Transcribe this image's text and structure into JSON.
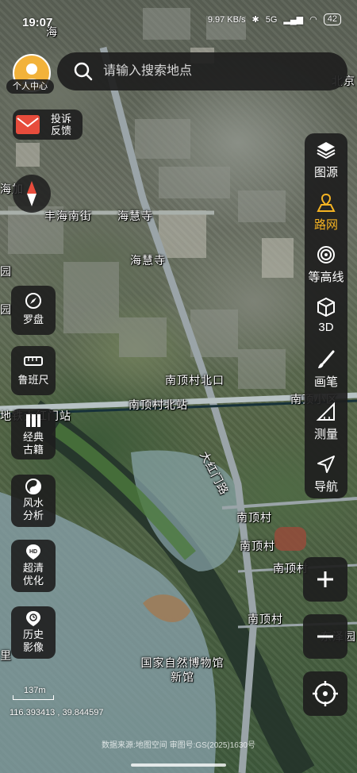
{
  "status_bar": {
    "time": "19:07",
    "net_speed": "9.97 KB/s",
    "signal": "5G",
    "battery": "42"
  },
  "search": {
    "placeholder": "请输入搜索地点"
  },
  "left_controls": {
    "profile_label": "个人中心",
    "feedback_label": "投诉反馈",
    "compass_label": "罗盘",
    "ruler_label": "鲁班尺",
    "classics_label": "经典古籍",
    "fengshui_label": "风水分析",
    "hd_label": "超清优化",
    "history_label": "历史影像"
  },
  "right_toolbar": {
    "items": [
      {
        "label": "图源",
        "icon": "layers-icon"
      },
      {
        "label": "路网",
        "icon": "road-network-icon"
      },
      {
        "label": "等高线",
        "icon": "contour-icon"
      },
      {
        "label": "3D",
        "icon": "cube-icon"
      },
      {
        "label": "画笔",
        "icon": "brush-icon"
      },
      {
        "label": "测量",
        "icon": "measure-icon"
      },
      {
        "label": "导航",
        "icon": "navigation-icon"
      }
    ],
    "active_index": 1,
    "active_color": "#f5b322"
  },
  "map_labels": {
    "fenghai_nanjie": "丰海南街",
    "haihuisi_1": "海慧寺",
    "haihuisi_2": "海慧寺",
    "nandingcun_beikou": "南顶村北口",
    "nandingcun_beizhan": "南顶村北站",
    "nanding_xiaoqu": "南顶小区",
    "dahongmen_lu": "大红门路",
    "nandingcun_1": "南顶村",
    "nandingcun_2": "南顶村",
    "nandingcun_3": "南顶村",
    "nandingcun_4": "南顶村",
    "dongzeyuan": "东泽园",
    "museum": "国家自然博物馆新馆",
    "subway_station": "地铁大红门站",
    "beijing_edge": "北京",
    "haihu_edge": "海",
    "li_edge": "里",
    "yuan_edge_1": "园",
    "yuan_edge_2": "园",
    "haijia_edge": "海加"
  },
  "scale": {
    "distance": "137m",
    "coordinates": "116.393413 , 39.844597"
  },
  "copyright": "数据来源:地图空间 审图号:GS(2025)1630号"
}
